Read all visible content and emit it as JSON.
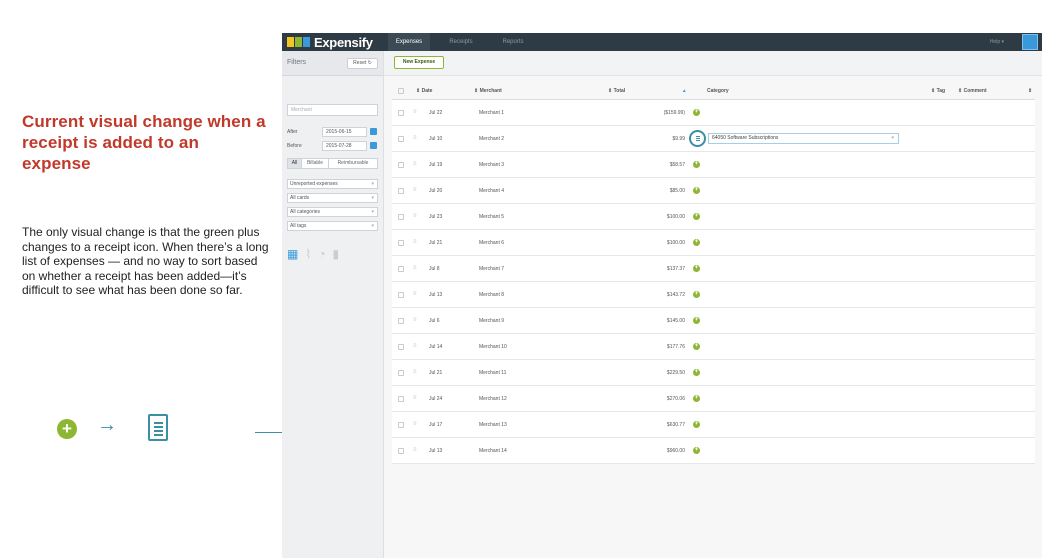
{
  "annotation": {
    "title": "Current visual change when a receipt is added to an expense",
    "body": "The only visual change is that the green plus changes to a receipt icon. When there’s a long list of expenses — and no way to sort based on whether a receipt has been added—it’s difficult to see what has been done so far.",
    "legend_plus": "+",
    "legend_arrow": "→"
  },
  "app": {
    "logo": "Expensify",
    "tabs": [
      "Expenses",
      "Receipts",
      "Reports"
    ],
    "help": "Help ▾",
    "colors": {
      "accent_green": "#8db733",
      "accent_blue": "#3a9ad9",
      "topbar": "#2f3b44",
      "annotation_red": "#c0392b"
    }
  },
  "sidebar": {
    "title": "Filters",
    "reset": "Reset ↻",
    "merchant_placeholder": "Merchant",
    "after_label": "After",
    "after_value": "2015-06-15",
    "before_label": "Before",
    "before_value": "2015-07-28",
    "segments": [
      "All",
      "Billable",
      "Reimbursable"
    ],
    "selects": [
      "Unreported expenses",
      "All cards",
      "All categories",
      "All tags"
    ]
  },
  "toolbar": {
    "new_expense": "New Expense"
  },
  "table": {
    "headers": {
      "date": "⇕ Date",
      "merchant": "⇕ Merchant",
      "total": "⇕ Total",
      "category": "Category",
      "tag": "⇕ Tag",
      "comment": "⇕ Comment",
      "sort": "▴",
      "last": "⇕"
    },
    "drag": "≡",
    "plus": "+",
    "rows": [
      {
        "date": "Jul 22",
        "merchant": "Merchant 1",
        "total": "($159.99)"
      },
      {
        "date": "Jul 10",
        "merchant": "Merchant 2",
        "total": "$9.99",
        "category": "64050 Software Subscriptions",
        "receipt": true
      },
      {
        "date": "Jul 19",
        "merchant": "Merchant 3",
        "total": "$58.57"
      },
      {
        "date": "Jul 20",
        "merchant": "Merchant 4",
        "total": "$85.00"
      },
      {
        "date": "Jul 23",
        "merchant": "Merchant 5",
        "total": "$100.00"
      },
      {
        "date": "Jul 21",
        "merchant": "Merchant 6",
        "total": "$100.00"
      },
      {
        "date": "Jul 8",
        "merchant": "Merchant 7",
        "total": "$137.37"
      },
      {
        "date": "Jul 13",
        "merchant": "Merchant 8",
        "total": "$143.72"
      },
      {
        "date": "Jul 6",
        "merchant": "Merchant 9",
        "total": "$145.00"
      },
      {
        "date": "Jul 14",
        "merchant": "Merchant 10",
        "total": "$177.76"
      },
      {
        "date": "Jul 21",
        "merchant": "Merchant 11",
        "total": "$229.50"
      },
      {
        "date": "Jul 24",
        "merchant": "Merchant 12",
        "total": "$270.06"
      },
      {
        "date": "Jul 17",
        "merchant": "Merchant 13",
        "total": "$630.77"
      },
      {
        "date": "Jul 13",
        "merchant": "Merchant 14",
        "total": "$960.00"
      }
    ]
  }
}
